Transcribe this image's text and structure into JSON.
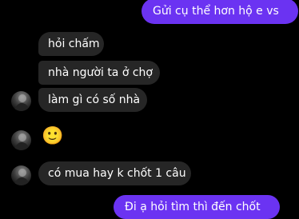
{
  "messages": {
    "m1": "Gửi cụ thể hơn hộ e vs",
    "m2": "hỏi chấm",
    "m3": "nhà người ta ở chợ",
    "m4": "làm gì có số nhà",
    "m5": "🙂",
    "m6": "có mua hay k chốt 1 câu",
    "m7": "Đi ạ hỏi tìm thì đến chốt"
  },
  "colors": {
    "background": "#000000",
    "incoming_bubble": "#262626",
    "outgoing_bubble": "#6B33F2"
  },
  "icons": [
    "avatar-photo",
    "slightly-smiling-face-emoji"
  ]
}
